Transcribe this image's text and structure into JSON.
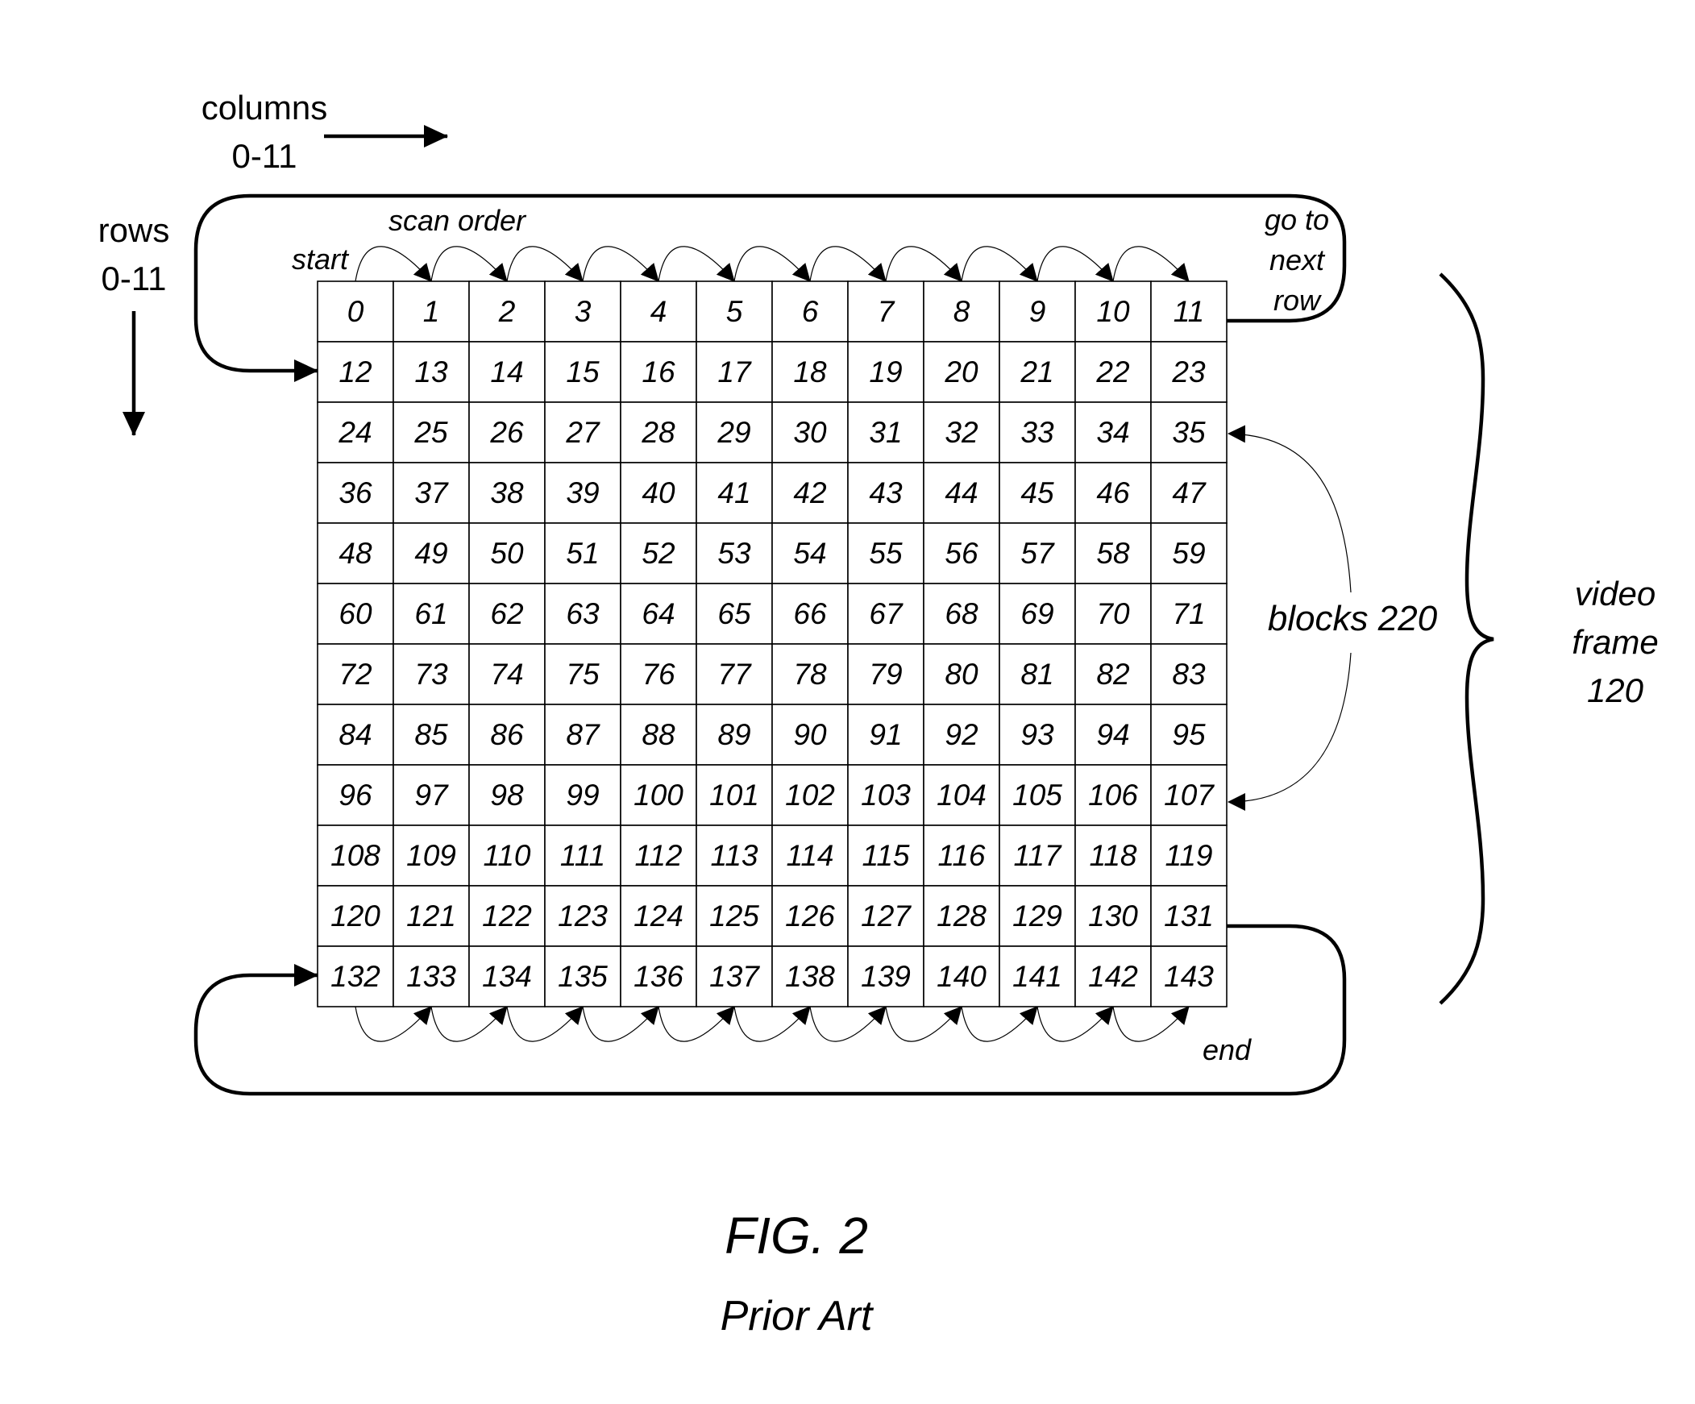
{
  "figure": {
    "title": "FIG. 2",
    "subtitle": "Prior Art",
    "axis_labels": {
      "columns": [
        "columns",
        "0-11"
      ],
      "rows": [
        "rows",
        "0-11"
      ]
    },
    "annotations": {
      "scan_order": "scan order",
      "start": "start",
      "go_to_next_row": [
        "go to",
        "next",
        "row"
      ],
      "end": "end",
      "blocks": "blocks 220",
      "video_frame": [
        "video",
        "frame",
        "120"
      ]
    },
    "grid": {
      "rows": 12,
      "columns": 12,
      "cells": [
        [
          "0",
          "1",
          "2",
          "3",
          "4",
          "5",
          "6",
          "7",
          "8",
          "9",
          "10",
          "11"
        ],
        [
          "12",
          "13",
          "14",
          "15",
          "16",
          "17",
          "18",
          "19",
          "20",
          "21",
          "22",
          "23"
        ],
        [
          "24",
          "25",
          "26",
          "27",
          "28",
          "29",
          "30",
          "31",
          "32",
          "33",
          "34",
          "35"
        ],
        [
          "36",
          "37",
          "38",
          "39",
          "40",
          "41",
          "42",
          "43",
          "44",
          "45",
          "46",
          "47"
        ],
        [
          "48",
          "49",
          "50",
          "51",
          "52",
          "53",
          "54",
          "55",
          "56",
          "57",
          "58",
          "59"
        ],
        [
          "60",
          "61",
          "62",
          "63",
          "64",
          "65",
          "66",
          "67",
          "68",
          "69",
          "70",
          "71"
        ],
        [
          "72",
          "73",
          "74",
          "75",
          "76",
          "77",
          "78",
          "79",
          "80",
          "81",
          "82",
          "83"
        ],
        [
          "84",
          "85",
          "86",
          "87",
          "88",
          "89",
          "90",
          "91",
          "92",
          "93",
          "94",
          "95"
        ],
        [
          "96",
          "97",
          "98",
          "99",
          "100",
          "101",
          "102",
          "103",
          "104",
          "105",
          "106",
          "107"
        ],
        [
          "108",
          "109",
          "110",
          "111",
          "112",
          "113",
          "114",
          "115",
          "116",
          "117",
          "118",
          "119"
        ],
        [
          "120",
          "121",
          "122",
          "123",
          "124",
          "125",
          "126",
          "127",
          "128",
          "129",
          "130",
          "131"
        ],
        [
          "132",
          "133",
          "134",
          "135",
          "136",
          "137",
          "138",
          "139",
          "140",
          "141",
          "142",
          "143"
        ]
      ]
    }
  }
}
